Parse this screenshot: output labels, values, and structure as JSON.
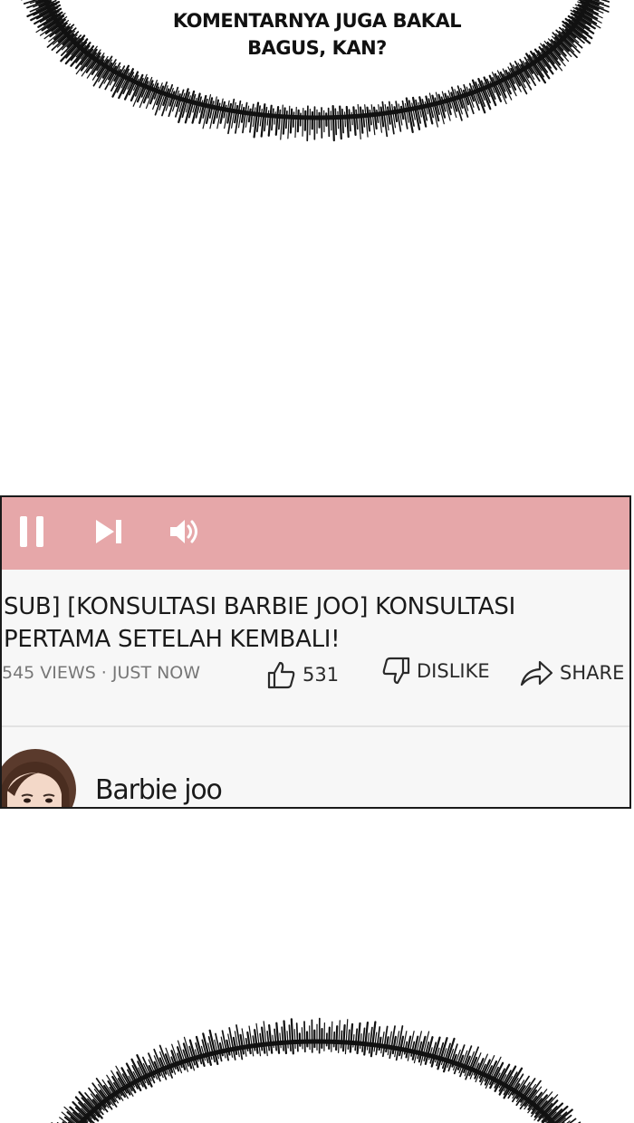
{
  "speech_bubble_top": {
    "line1": "KOMENTARNYA JUGA BAKAL",
    "line2": "BAGUS, KAN?"
  },
  "player": {
    "controls": {
      "pause_icon": "pause-icon",
      "next_icon": "skip-next-icon",
      "volume_icon": "volume-icon",
      "bar_color": "#e6a7a9"
    },
    "title_line1": "SUB] [KONSULTASI BARBIE JOO] KONSULTASI",
    "title_line2": "PERTAMA SETELAH KEMBALI!",
    "meta": "545 VIEWS · JUST NOW",
    "like_count": "531",
    "dislike_label": "DISLIKE",
    "share_label": "SHARE",
    "channel_name": "Barbie joo"
  }
}
